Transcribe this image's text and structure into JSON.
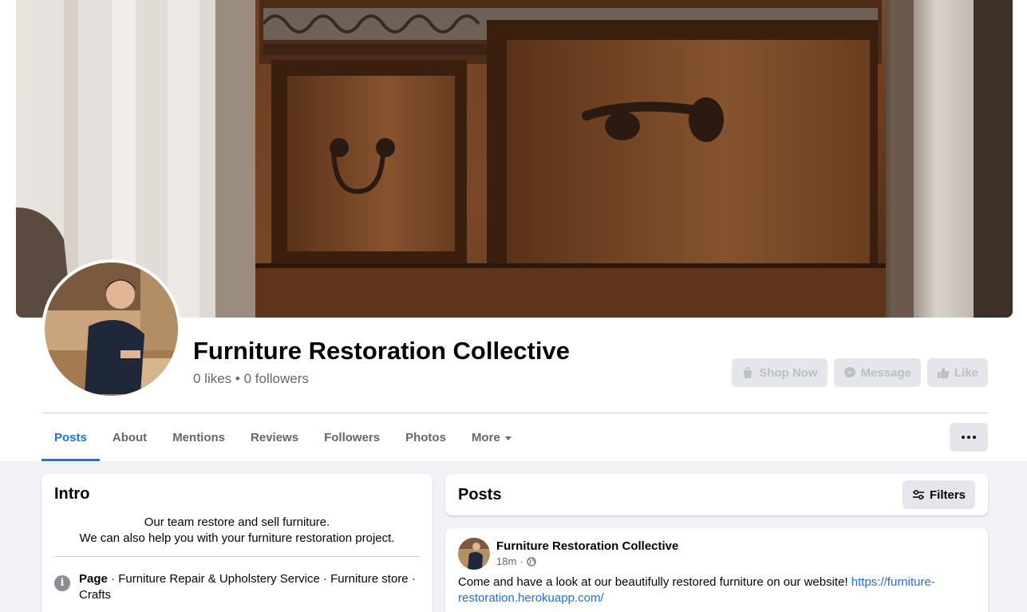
{
  "page": {
    "name": "Furniture Restoration Collective",
    "likes_text": "0 likes",
    "sep": "•",
    "followers_text": "0 followers"
  },
  "actions": {
    "shop_now": "Shop Now",
    "message": "Message",
    "like": "Like"
  },
  "tabs": [
    "Posts",
    "About",
    "Mentions",
    "Reviews",
    "Followers",
    "Photos",
    "More"
  ],
  "intro": {
    "title": "Intro",
    "bio_line1": "Our team restore and sell furniture.",
    "bio_line2": "We can also help you with your furniture restoration project.",
    "category_label": "Page",
    "category_text": " · Furniture Repair & Upholstery Service · Furniture store · Crafts"
  },
  "posts_section": {
    "title": "Posts",
    "filters_label": "Filters"
  },
  "post": {
    "author": "Furniture Restoration Collective",
    "time": "18m",
    "dot": "·",
    "text": "Come and have a look at our beautifully restored furniture on our website! ",
    "link": "https://furniture-restoration.herokuapp.com/"
  },
  "colors": {
    "accent": "#1b74e4",
    "secondary_text": "#65676b",
    "disabled_button": "#e4e6eb",
    "background": "#f0f2f5"
  },
  "icons": {
    "shop": "shopping-bag-icon",
    "message": "messenger-icon",
    "like": "thumbs-up-icon",
    "more_caret": "caret-down-icon",
    "dots": "ellipsis-icon",
    "filters": "sliders-icon",
    "info": "info-icon",
    "privacy": "globe-icon"
  }
}
